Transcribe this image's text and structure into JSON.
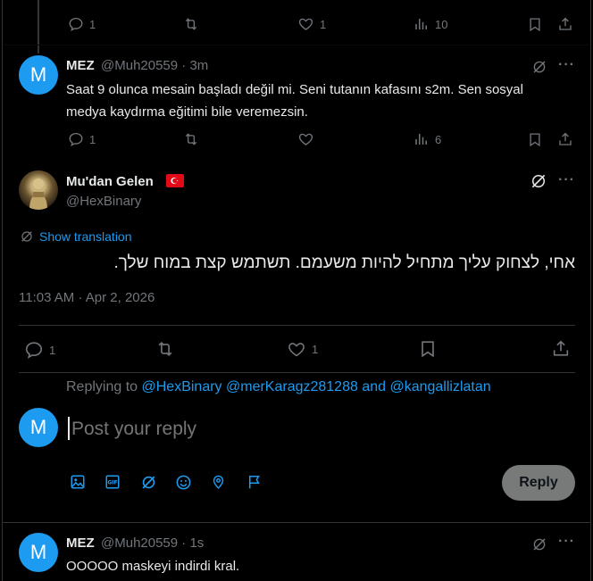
{
  "top_actions": {
    "replies": "1",
    "reposts": "",
    "likes": "1",
    "views": "10"
  },
  "reply1": {
    "name": "MEZ",
    "handle": "@Muh20559 · 3m",
    "avatar_letter": "M",
    "text": "Saat 9 olunca mesain başladı değil mi. Seni tutanın kafasını s2m. Sen sosyal medya kaydırma eğitimi bile veremezsin.",
    "actions": {
      "replies": "1",
      "views": "6"
    }
  },
  "main": {
    "name": "Mu'dan Gelen",
    "flag": "🇹🇷",
    "handle": "@HexBinary",
    "show_translation": "Show translation",
    "text": "אחי, לצחוק עליך מתחיל להיות משעמם. תשתמש קצת במוח שלך.",
    "timestamp": "11:03 AM · Apr 2, 2026",
    "actions": {
      "replies": "1",
      "likes": "1"
    }
  },
  "composer": {
    "replying_to_prefix": "Replying to",
    "replying_to_users": "@HexBinary @merKaragz281288 and @kangallizlatan",
    "avatar_letter": "M",
    "placeholder": "Post your reply",
    "reply_button": "Reply"
  },
  "reply2": {
    "name": "MEZ",
    "handle": "@Muh20559 · 1s",
    "avatar_letter": "M",
    "text": "OOOOO maskeyi indirdi kral."
  },
  "colors": {
    "accent": "#1d9bf0",
    "muted": "#71767b",
    "divider": "#2f3336",
    "background": "#000000"
  }
}
